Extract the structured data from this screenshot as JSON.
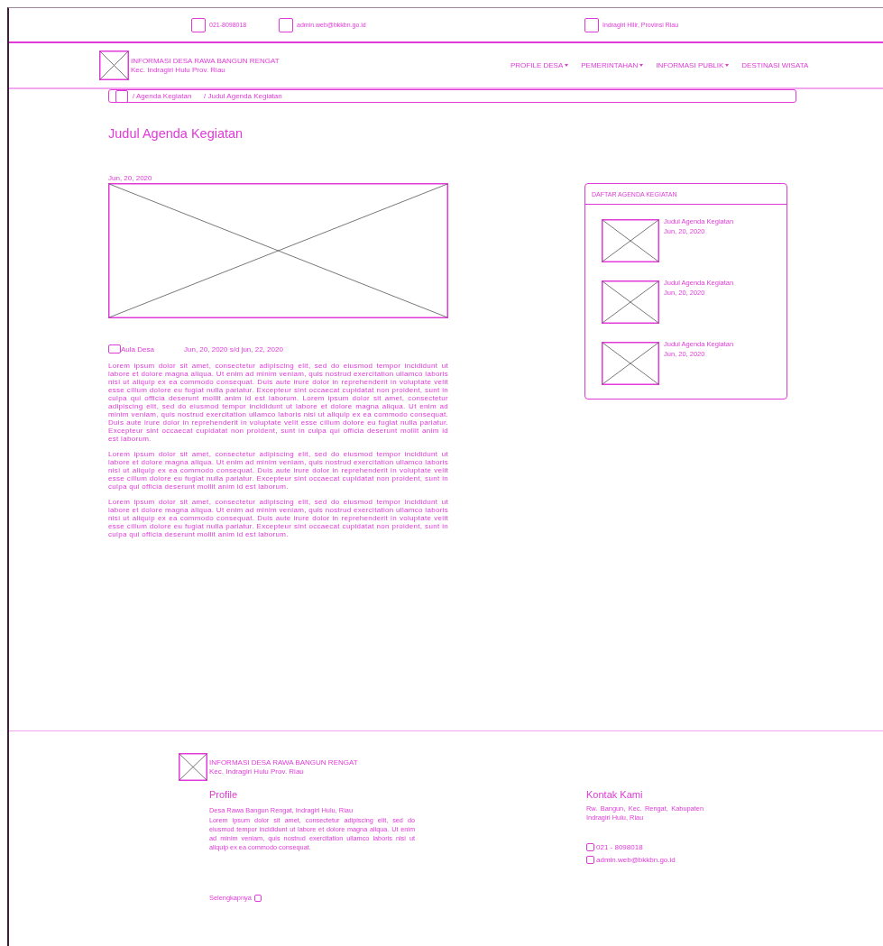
{
  "top_bar": {
    "phone": "021-8098018",
    "email": "admin.web@bkkbn.go.id",
    "location": "Indragiri Hilir, Provinsi Riau"
  },
  "header": {
    "site_title": "INFORMASI DESA RAWA BANGUN RENGAT",
    "site_subtitle": "Kec. Indragiri Hulu Prov. Riau",
    "nav": [
      {
        "label": "PROFILE DESA",
        "dropdown": true
      },
      {
        "label": "PEMERINTAHAN",
        "dropdown": true
      },
      {
        "label": "INFORMASI PUBLIK",
        "dropdown": true
      },
      {
        "label": "DESTINASI WISATA",
        "dropdown": false
      }
    ]
  },
  "breadcrumb": [
    "/ Agenda Kegiatan",
    "/ Judul Agenda Kegiatan"
  ],
  "article": {
    "title": "Judul Agenda Kegiatan",
    "date": "Jun, 20, 2020",
    "location": "Aula Desa",
    "period": "Jun, 20, 2020 s/d jun, 22, 2020",
    "paragraphs": [
      "Lorem ipsum dolor sit amet, consectetur adipiscing elit, sed do eiusmod tempor incididunt ut labore et dolore magna aliqua. Ut enim ad minim veniam, quis nostrud exercitation ullamco laboris nisi ut aliquip ex ea commodo consequat. Duis aute irure dolor in reprehenderit in voluptate velit esse cillum dolore eu fugiat nulla pariatur. Excepteur sint occaecat cupidatat non proident, sunt in culpa qui officia deserunt mollit anim id est laborum. Lorem ipsum dolor sit amet, consectetur adipiscing elit, sed do eiusmod tempor incididunt ut labore et dolore magna aliqua. Ut enim ad minim veniam, quis nostrud exercitation ullamco laboris nisi ut aliquip ex ea commodo consequat. Duis aute irure dolor in reprehenderit in voluptate velit esse cillum dolore eu fugiat nulla pariatur. Excepteur sint occaecat cupidatat non proident, sunt in culpa qui officia deserunt mollit anim id est laborum.",
      "Lorem ipsum dolor sit amet, consectetur adipiscing elit, sed do eiusmod tempor incididunt ut labore et dolore magna aliqua. Ut enim ad minim veniam, quis nostrud exercitation ullamco laboris nisi ut aliquip ex ea commodo consequat. Duis aute irure dolor in reprehenderit in voluptate velit esse cillum dolore eu fugiat nulla pariatur. Excepteur sint occaecat cupidatat non proident, sunt in culpa qui officia deserunt mollit anim id est laborum.",
      "Lorem ipsum dolor sit amet, consectetur adipiscing elit, sed do eiusmod tempor incididunt ut labore et dolore magna aliqua. Ut enim ad minim veniam, quis nostrud exercitation ullamco laboris nisi ut aliquip ex ea commodo consequat. Duis aute irure dolor in reprehenderit in voluptate velit esse cillum dolore eu fugiat nulla pariatur. Excepteur sint occaecat cupidatat non proident, sunt in culpa qui officia deserunt mollit anim id est laborum."
    ]
  },
  "sidebar": {
    "title": "DAFTAR AGENDA KEGIATAN",
    "items": [
      {
        "title": "Judul Agenda Kegiatan",
        "date": "Jun, 20, 2020"
      },
      {
        "title": "Judul Agenda Kegiatan",
        "date": "Jun, 20, 2020"
      },
      {
        "title": "Judul Agenda Kegiatan",
        "date": "Jun, 20, 2020"
      }
    ]
  },
  "footer": {
    "site_title": "INFORMASI DESA RAWA BANGUN RENGAT",
    "site_subtitle": "Kec. Indragiri Hulu Prov. Riau",
    "profile": {
      "heading": "Profile",
      "subtitle": "Desa Rawa Bangun Rengat, Indragiri Hulu, Riau",
      "text": "Lorem ipsum dolor sit amet, consectetur adipiscing elit, sed do eiusmod tempor incididunt ut labore et dolore magna aliqua. Ut enim ad minim veniam, quis nostrud exercitation ullamco laboris nisi ut aliquip ex ea commodo consequat.",
      "more_link": "Selengkapnya"
    },
    "contact": {
      "heading": "Kontak Kami",
      "address": "Rw. Bangun, Kec. Rengat, Kabupaten Indragiri Hulu, Riau",
      "phone": "021 - 8098018",
      "email": "admin.web@bkkbn.go.id"
    }
  }
}
